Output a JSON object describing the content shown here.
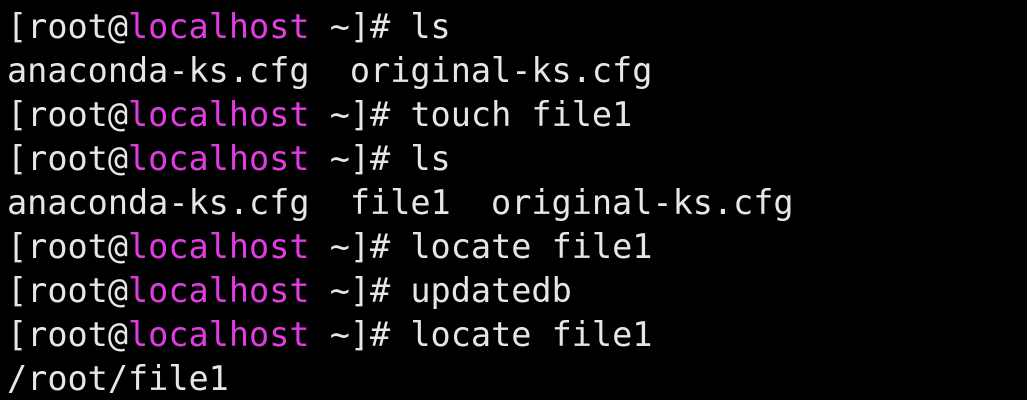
{
  "colors": {
    "background": "#000000",
    "foreground": "#e6e6e6",
    "hostname": "#e03ce0"
  },
  "prompt": {
    "open": "[root@",
    "host": "localhost",
    "close": " ~]# "
  },
  "lines": [
    {
      "type": "prompt",
      "command": "ls"
    },
    {
      "type": "output",
      "text": "anaconda-ks.cfg  original-ks.cfg"
    },
    {
      "type": "prompt",
      "command": "touch file1"
    },
    {
      "type": "prompt",
      "command": "ls"
    },
    {
      "type": "output",
      "text": "anaconda-ks.cfg  file1  original-ks.cfg"
    },
    {
      "type": "prompt",
      "command": "locate file1"
    },
    {
      "type": "prompt",
      "command": "updatedb"
    },
    {
      "type": "prompt",
      "command": "locate file1"
    },
    {
      "type": "output",
      "text": "/root/file1"
    }
  ]
}
